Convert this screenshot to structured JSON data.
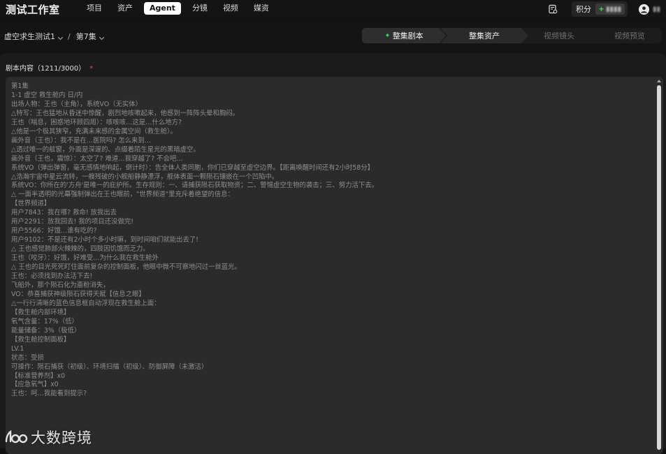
{
  "app": {
    "logo_text": "测试工作室"
  },
  "nav": {
    "items": [
      {
        "label": "项目"
      },
      {
        "label": "资产"
      },
      {
        "label": "Agent"
      },
      {
        "label": "分镜"
      },
      {
        "label": "视频"
      },
      {
        "label": "媒资"
      }
    ],
    "active": "Agent"
  },
  "header_right": {
    "points_label": "积分",
    "points_value": "▮▮▮▮",
    "username": "▮▮"
  },
  "breadcrumb": {
    "project": "虚空求生测试1",
    "separator": "/",
    "episode": "第7集"
  },
  "steps": [
    {
      "label": "整集剧本",
      "state": "active"
    },
    {
      "label": "整集资产",
      "state": "active"
    },
    {
      "label": "视频镜头",
      "state": "disabled"
    },
    {
      "label": "视频预览",
      "state": "disabled"
    }
  ],
  "editor": {
    "label": "剧本内容（1211/3000）",
    "required_mark": "*",
    "lines": [
      "第1集",
      "1-1 虚空 救生舱内 日/内",
      "出场人物：王也（主角），系统VO（无实体）",
      "△特写：王也猛地从昏迷中惊醒，剧烈地咳嗽起来，他感到一阵阵头晕和胸闷。",
      "王也（喘息，困惑地环顾四周）：咳咳咳…这是…什么地方?",
      "△他是一个极其狭窄，充满未来感的金属空间（救生舱）。",
      "画外音（王也）：我不是在…医院吗? 怎么来到…",
      "△透过唯一的舷窗，外面是深邃的、点缀着陌生星光的黑暗虚空。",
      "画外音（王也，震惊）：太空了? 难道…我穿越了? 不会吧…",
      "系统VO（弹出弹窗，毫无感情地响起，倒计时）：告全体人类同胞，你们已穿越至虚空边界。【距离唤醒时间还有2小时58分】",
      "△浩瀚宇宙中星云流转，一艘残破的小舰船静静漂浮，舰体表面一颗陨石镶嵌在一个凹陷中。",
      "系统VO：你所在的'方舟'是唯一的庇护所。生存规则：一、请捕获陨石获取物资；二、警惕虚空生物的袭击；三、努力活下去。",
      "△ 一面半透明的光幕强制弹出在王也眼前，\"世界频道\"里充斥着绝望的信息：",
      "【世界频道】",
      "用户7843：我在哪? 救命! 放我出去",
      "用户2291：放我回去! 我的项目还没做完!",
      "用户5566：好饿…谁有吃的?",
      "用户9102：不是还有2小时个多小时嘛，到时间咱们就能出去了!",
      "△ 王也感觉肺部火辣辣的，四肢因饥饿而乏力。",
      "王也（咬牙）：好饿，好难受…为什么我在救生舱外",
      "△ 王也的目光死死盯住面前复杂的控制面板，他眼中微不可察地闪过一丝蓝光。",
      "王也：必须找到办法活下去!",
      "飞船外，那个陨石化为齑粉消失，",
      "VO：恭喜捕获神级陨石获得天赋【信息之眼】",
      "△一行行清晰的蓝色信息框自动浮现在救生舱上面：",
      "【救生舱内部环境】",
      "氧气含量：17%（低）",
      "能量储备：3%（极低）",
      "【救生舱控制面板】",
      "LV.1",
      "状态：受损",
      "可操作：陨石捕获（初级）、环境扫描（初级）、防御屏障（未激活）",
      "【标准营养剂】x0",
      "【应急氧气】x0",
      "王也：呵…我能看到提示?"
    ]
  },
  "watermark": {
    "text": "大数跨境"
  }
}
